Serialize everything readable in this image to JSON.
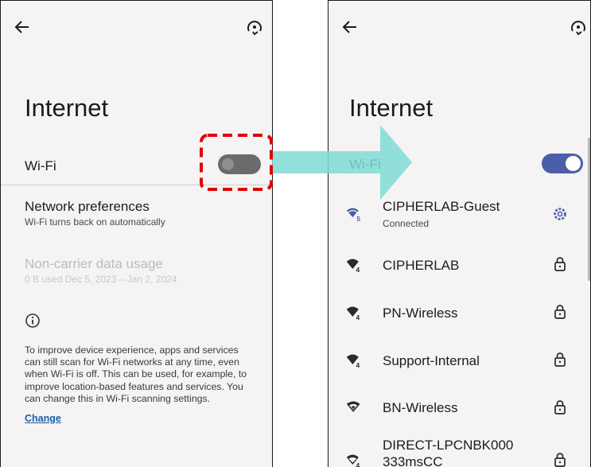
{
  "left_screen": {
    "title": "Internet",
    "wifi_label": "Wi-Fi",
    "wifi_enabled": false,
    "network_preferences": {
      "title": "Network preferences",
      "subtitle": "Wi-Fi turns back on automatically"
    },
    "non_carrier": {
      "title": "Non-carrier data usage",
      "subtitle": "0 B used Dec 5, 2023 – Jan 2, 2024"
    },
    "info_lines": [
      "To improve device experience, apps and services",
      "can still scan for Wi-Fi networks at any time, even",
      "when Wi-Fi is off. This can be used, for example, to",
      "improve location-based features and services. You",
      "can change this in Wi-Fi scanning settings."
    ],
    "change_link": "Change"
  },
  "right_screen": {
    "title": "Internet",
    "wifi_label": "Wi-Fi",
    "wifi_enabled": true,
    "networks": [
      {
        "name": "CIPHERLAB-Guest",
        "status": "Connected",
        "band_badge": "5",
        "action_icon": "gear-icon"
      },
      {
        "name": "CIPHERLAB",
        "status": "",
        "band_badge": "4",
        "action_icon": "lock-icon"
      },
      {
        "name": "PN-Wireless",
        "status": "",
        "band_badge": "4",
        "action_icon": "lock-icon"
      },
      {
        "name": "Support-Internal",
        "status": "",
        "band_badge": "4",
        "action_icon": "lock-icon"
      },
      {
        "name": "BN-Wireless",
        "status": "",
        "band_badge": "",
        "action_icon": "lock-icon"
      },
      {
        "name": "DIRECT-LPCNBK000",
        "status": "",
        "band_badge": "4",
        "action_icon": "lock-icon"
      }
    ],
    "partial_text": "333msCC"
  },
  "colors": {
    "accent": "#4a5fa8",
    "highlight": "#e00000",
    "arrow": "#7fdbd6",
    "toggle_off": "#6a6a6a"
  }
}
